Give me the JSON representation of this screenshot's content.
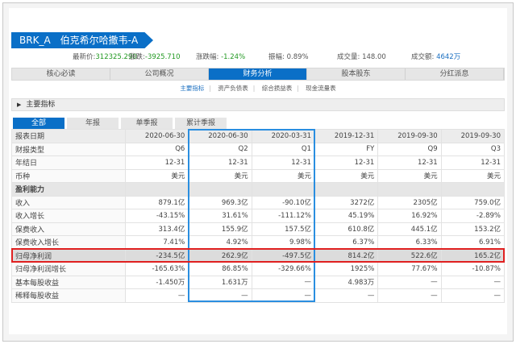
{
  "header": {
    "ticker": "BRK_A",
    "name": "伯克希尔哈撒韦-A"
  },
  "stats": {
    "price_label": "最新价:",
    "price": "312325.290",
    "change_label": "涨跌:",
    "change": "-3925.710",
    "pct_label": "涨跌幅:",
    "pct": "-1.24%",
    "amp_label": "振幅:",
    "amp": "0.89%",
    "vol_label": "成交量:",
    "vol": "148.00",
    "amount_label": "成交额:",
    "amount": "4642万"
  },
  "tabs": [
    "核心必读",
    "公司概况",
    "财务分析",
    "股本股东",
    "分红派息"
  ],
  "subtabs": [
    "主要指标",
    "资产负债表",
    "综合损益表",
    "现金流量表"
  ],
  "section": "主要指标",
  "filter_tabs": [
    "全部",
    "年报",
    "单季报",
    "累计季报"
  ],
  "table": {
    "header": [
      "报表日期",
      "2020-06-30",
      "2020-06-30",
      "2020-03-31",
      "2019-12-31",
      "2019-09-30",
      "2019-09-30"
    ],
    "rows": [
      {
        "type": "row",
        "cells": [
          "财报类型",
          "Q6",
          "Q2",
          "Q1",
          "FY",
          "Q9",
          "Q3"
        ]
      },
      {
        "type": "row",
        "cells": [
          "年结日",
          "12-31",
          "12-31",
          "12-31",
          "12-31",
          "12-31",
          "12-31"
        ]
      },
      {
        "type": "row",
        "cells": [
          "币种",
          "美元",
          "美元",
          "美元",
          "美元",
          "美元",
          "美元"
        ]
      },
      {
        "type": "group",
        "cells": [
          "盈利能力",
          "",
          "",
          "",
          "",
          "",
          ""
        ]
      },
      {
        "type": "row",
        "cells": [
          "收入",
          "879.1亿",
          "969.3亿",
          "-90.10亿",
          "3272亿",
          "2305亿",
          "759.0亿"
        ]
      },
      {
        "type": "row",
        "cells": [
          "收入增长",
          "-43.15%",
          "31.61%",
          "-111.12%",
          "45.19%",
          "16.92%",
          "-2.89%"
        ]
      },
      {
        "type": "row",
        "cells": [
          "保费收入",
          "313.4亿",
          "155.9亿",
          "157.5亿",
          "610.8亿",
          "445.1亿",
          "153.2亿"
        ]
      },
      {
        "type": "row",
        "cells": [
          "保费收入增长",
          "7.41%",
          "4.92%",
          "9.98%",
          "6.37%",
          "6.33%",
          "6.91%"
        ]
      },
      {
        "type": "hl",
        "cells": [
          "归母净利润",
          "-234.5亿",
          "262.9亿",
          "-497.5亿",
          "814.2亿",
          "522.6亿",
          "165.2亿"
        ]
      },
      {
        "type": "row",
        "cells": [
          "归母净利润增长",
          "-165.63%",
          "86.85%",
          "-329.66%",
          "1925%",
          "77.67%",
          "-10.87%"
        ]
      },
      {
        "type": "row",
        "cells": [
          "基本每股收益",
          "-1.450万",
          "1.631万",
          "—",
          "4.983万",
          "—",
          "—"
        ]
      },
      {
        "type": "row",
        "cells": [
          "稀释每股收益",
          "—",
          "—",
          "—",
          "—",
          "—",
          "—"
        ]
      }
    ]
  }
}
